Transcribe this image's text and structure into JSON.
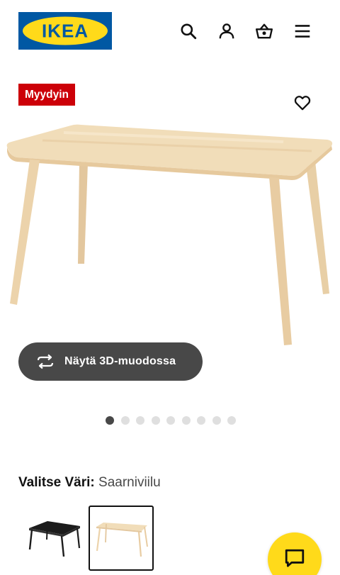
{
  "brand": {
    "name": "IKEA",
    "logo_blue": "#0058a3",
    "logo_yellow": "#ffda1a"
  },
  "header": {
    "icons": [
      "search-icon",
      "account-icon",
      "shopping-bag-icon",
      "menu-icon"
    ]
  },
  "product": {
    "badge": "Myydyin",
    "badge_color": "#cc0008",
    "favourite_icon": "heart-icon",
    "image_colors": {
      "wood_top": "#f1ddb9",
      "wood_edge": "#e6c99d",
      "wood_leg": "#ecd3ab"
    }
  },
  "view3d": {
    "label": "Näytä 3D-muodossa",
    "icon": "rotate-3d-icon",
    "bg": "#484848"
  },
  "carousel": {
    "count": 9,
    "active_index": 1
  },
  "color_select": {
    "label": "Valitse Väri:",
    "value": "Saarniviilu",
    "options": [
      {
        "name": "black-table-swatch",
        "color": "#222222",
        "selected": false
      },
      {
        "name": "ash-veneer-table-swatch",
        "color": "#ecd3ab",
        "selected": true
      }
    ]
  },
  "chat": {
    "icon": "chat-icon",
    "bg": "#ffda1a"
  }
}
